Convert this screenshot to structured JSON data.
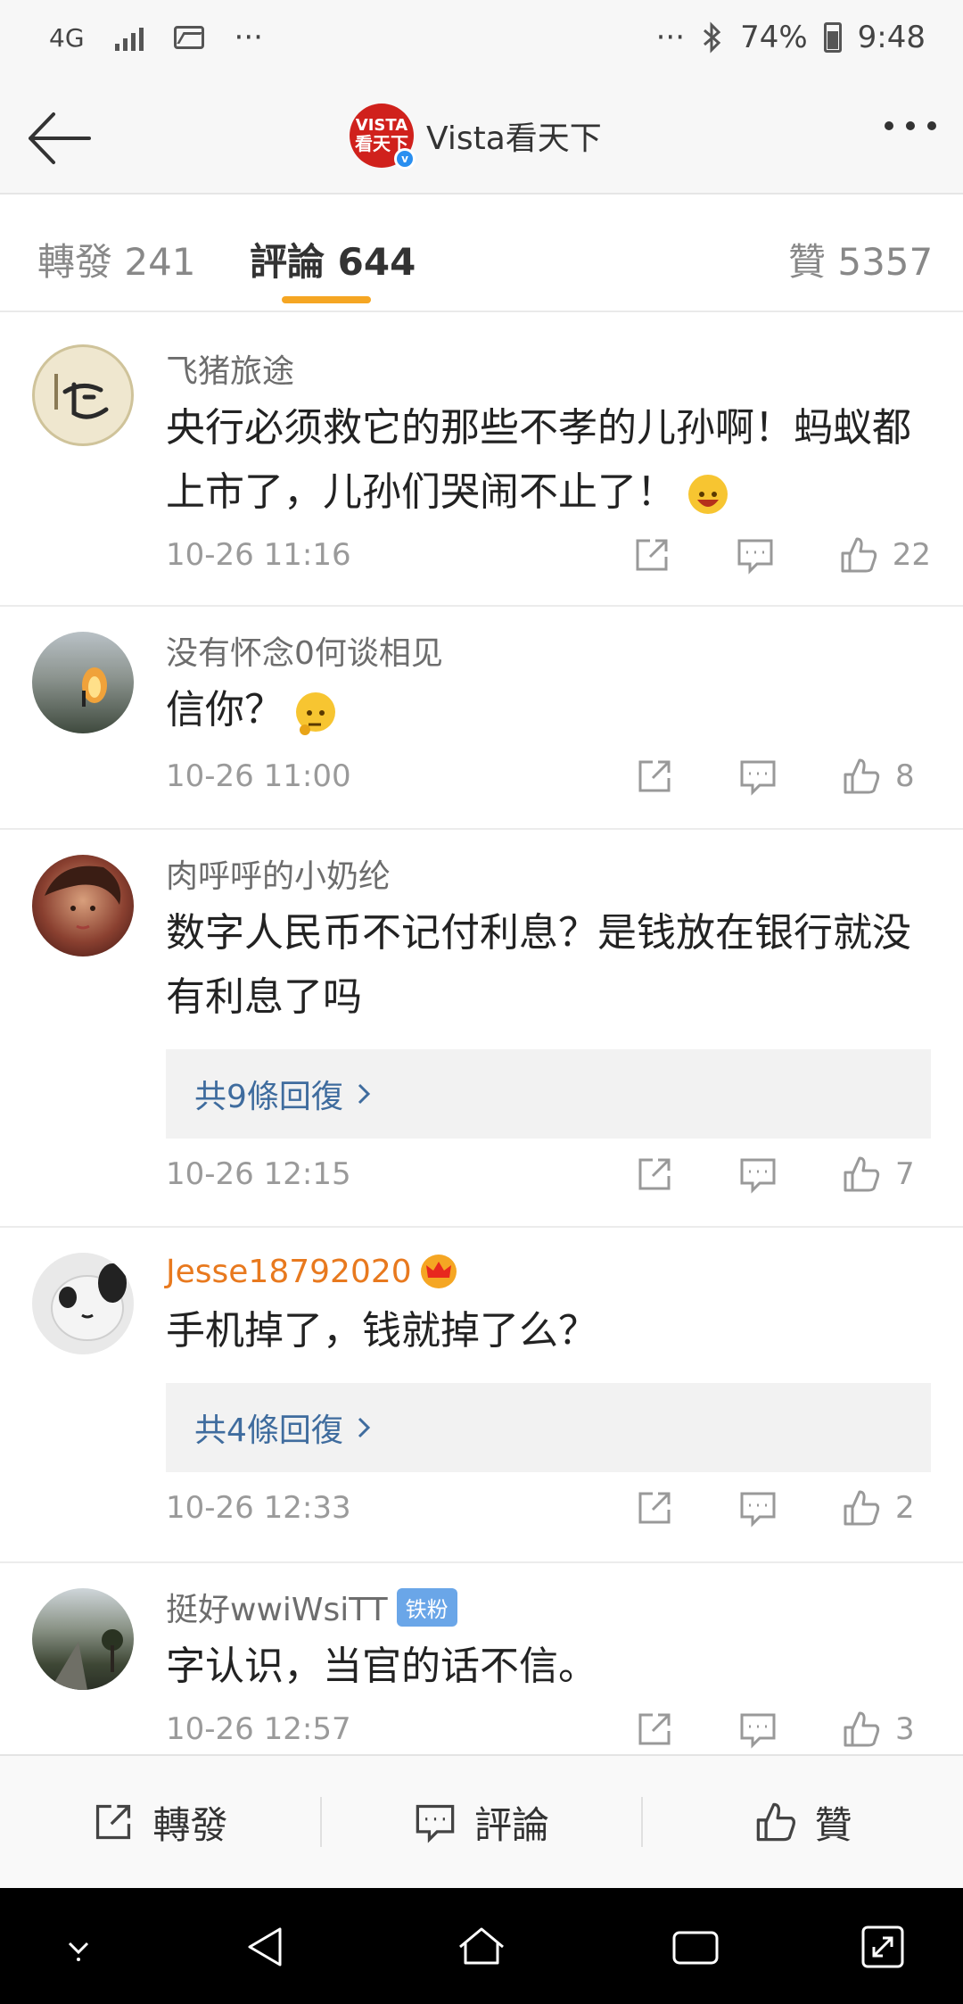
{
  "status_bar": {
    "network": "4G",
    "more": "···",
    "more_right": "···",
    "battery": "74%",
    "time": "9:48"
  },
  "header": {
    "title": "Vista看天下",
    "logo_line1": "VISTA",
    "logo_line2": "看天下",
    "verified_mark": "v"
  },
  "tabs": [
    {
      "label": "轉發 241"
    },
    {
      "label": "評論 644"
    },
    {
      "label": "贊 5357"
    }
  ],
  "comments": [
    {
      "user": "飞猪旅途",
      "text": "央行必须救它的那些不孝的儿孙啊！蚂蚁都上市了，儿孙们哭闹不止了！",
      "emoji": "laughing-emoji",
      "date": "10-26 11:16",
      "likes": "22"
    },
    {
      "user": "没有怀念0何谈相见",
      "text": "信你？",
      "emoji": "thinking-emoji",
      "date": "10-26 11:00",
      "likes": "8"
    },
    {
      "user": "肉呼呼的小奶纶",
      "text": "数字人民币不记付利息？是钱放在银行就没有利息了吗",
      "replies": "共9條回復",
      "date": "10-26 12:15",
      "likes": "7"
    },
    {
      "user": "Jesse18792020",
      "text": "手机掉了，钱就掉了么？",
      "replies": "共4條回復",
      "date": "10-26 12:33",
      "likes": "2"
    },
    {
      "user": "挺好wwiWsiTT",
      "badge": "铁粉",
      "text": "字认识，当官的话不信。",
      "date": "10-26 12:57",
      "likes": "3"
    }
  ],
  "bottom_bar": {
    "repost": "轉發",
    "comment": "評論",
    "like": "贊"
  },
  "colors": {
    "accent": "#f5a623",
    "link": "#3f6c9e",
    "vip_name": "#e8791e",
    "brand_red": "#d0211c"
  }
}
